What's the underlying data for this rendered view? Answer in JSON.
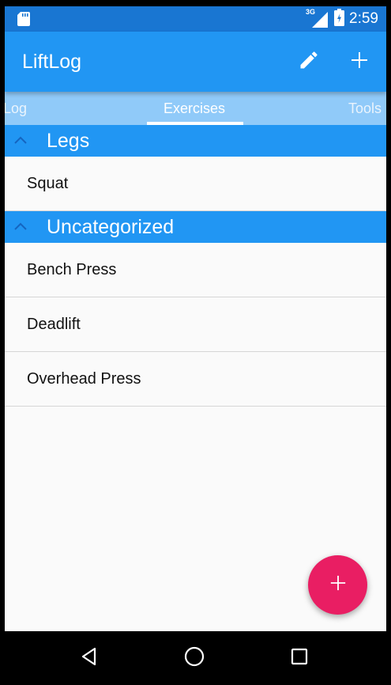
{
  "status_bar": {
    "time": "2:59",
    "network_label": "3G",
    "icons": [
      "sd-card-icon",
      "signal-icon",
      "battery-icon"
    ]
  },
  "app_bar": {
    "title": "LiftLog",
    "actions": [
      "edit-icon",
      "add-icon"
    ]
  },
  "tabs": [
    {
      "label": "Log",
      "active": false
    },
    {
      "label": "Exercises",
      "active": true
    },
    {
      "label": "Tools",
      "active": false
    }
  ],
  "sections": [
    {
      "title": "Legs",
      "items": [
        {
          "label": "Squat"
        }
      ]
    },
    {
      "title": "Uncategorized",
      "items": [
        {
          "label": "Bench Press"
        },
        {
          "label": "Deadlift"
        },
        {
          "label": "Overhead Press"
        }
      ]
    }
  ],
  "fab": {
    "icon": "add-icon"
  },
  "nav_bar": {
    "buttons": [
      "back-icon",
      "home-icon",
      "recents-icon"
    ]
  },
  "colors": {
    "status_bar": "#1976d2",
    "primary": "#2196f3",
    "tab_bar": "#90caf9",
    "accent": "#e91e63",
    "background": "#fafafa"
  }
}
